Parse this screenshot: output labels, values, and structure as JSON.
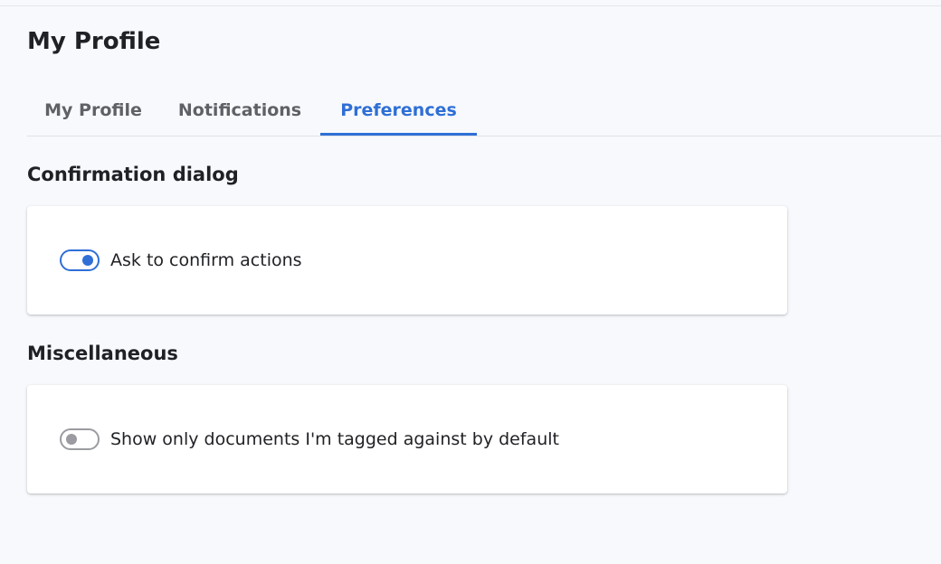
{
  "page": {
    "title": "My Profile"
  },
  "tabs": [
    {
      "label": "My Profile",
      "active": false
    },
    {
      "label": "Notifications",
      "active": false
    },
    {
      "label": "Preferences",
      "active": true
    }
  ],
  "sections": [
    {
      "title": "Confirmation dialog",
      "setting": {
        "label": "Ask to confirm actions",
        "enabled": true
      }
    },
    {
      "title": "Miscellaneous",
      "setting": {
        "label": "Show only documents I'm tagged against by default",
        "enabled": false
      }
    }
  ],
  "colors": {
    "accent": "#2f6fd6",
    "toggle_off": "#9a9ca1",
    "background": "#f8f9fc"
  }
}
